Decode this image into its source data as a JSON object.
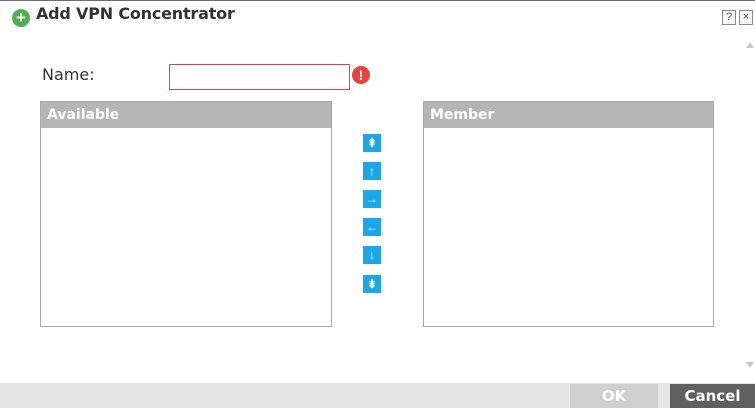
{
  "dialog": {
    "title": "Add VPN Concentrator",
    "help_label": "?",
    "close_label": "×"
  },
  "form": {
    "name_label": "Name:",
    "name_value": "",
    "error_symbol": "!"
  },
  "lists": {
    "available_header": "Available",
    "member_header": "Member"
  },
  "move_buttons": {
    "move_all_up": "⇞",
    "move_up": "↑",
    "add_to_member": "→",
    "remove_from_member": "←",
    "move_down": "↓",
    "move_all_down": "⇟"
  },
  "footer": {
    "ok_label": "OK",
    "cancel_label": "Cancel"
  },
  "colors": {
    "accent_blue": "#1ea7e8",
    "error_red": "#e8413f",
    "header_gray": "#b5b5b5",
    "add_green": "#4caf50"
  }
}
